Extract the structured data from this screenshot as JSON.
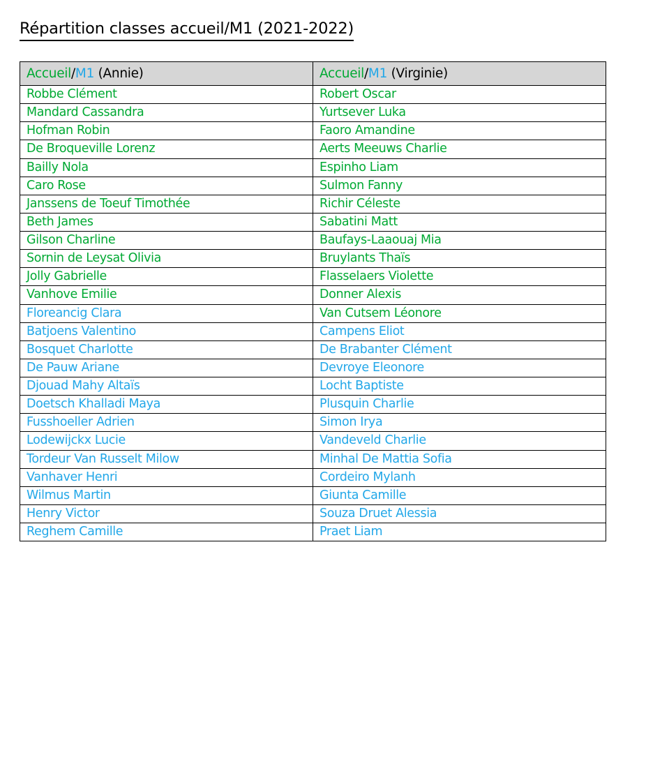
{
  "document": {
    "title": "Répartition classes accueil/M1 (2021-2022)"
  },
  "colors": {
    "accueil_green": "#00a933",
    "m1_blue": "#22a7e8",
    "header_background": "#d6d6d6",
    "border": "#000000",
    "text_black": "#000000"
  },
  "table": {
    "header": {
      "col1": {
        "accueil_label": "Accueil",
        "separator": "/",
        "m1_label": "M1",
        "teacher": "(Annie)"
      },
      "col2": {
        "accueil_label": "Accueil",
        "separator": "/",
        "m1_label": "M1",
        "teacher": "(Virginie)"
      }
    },
    "rows": [
      {
        "col1": {
          "name": "Robbe Clément",
          "group": "accueil"
        },
        "col2": {
          "name": "Robert Oscar",
          "group": "accueil"
        }
      },
      {
        "col1": {
          "name": "Mandard Cassandra",
          "group": "accueil"
        },
        "col2": {
          "name": "Yurtsever Luka",
          "group": "accueil"
        }
      },
      {
        "col1": {
          "name": "Hofman Robin",
          "group": "accueil"
        },
        "col2": {
          "name": "Faoro Amandine",
          "group": "accueil"
        }
      },
      {
        "col1": {
          "name": "De Broqueville Lorenz",
          "group": "accueil"
        },
        "col2": {
          "name": "Aerts Meeuws Charlie",
          "group": "accueil"
        }
      },
      {
        "col1": {
          "name": "Bailly Nola",
          "group": "accueil"
        },
        "col2": {
          "name": "Espinho Liam",
          "group": "accueil"
        }
      },
      {
        "col1": {
          "name": "Caro Rose",
          "group": "accueil"
        },
        "col2": {
          "name": "Sulmon Fanny",
          "group": "accueil"
        }
      },
      {
        "col1": {
          "name": "Janssens de Toeuf Timothée",
          "group": "accueil"
        },
        "col2": {
          "name": "Richir Céleste",
          "group": "accueil"
        }
      },
      {
        "col1": {
          "name": "Beth James",
          "group": "accueil"
        },
        "col2": {
          "name": "Sabatini Matt",
          "group": "accueil"
        }
      },
      {
        "col1": {
          "name": "Gilson Charline",
          "group": "accueil"
        },
        "col2": {
          "name": "Baufays-Laaouaj Mia",
          "group": "accueil"
        }
      },
      {
        "col1": {
          "name": "Sornin de Leysat Olivia",
          "group": "accueil"
        },
        "col2": {
          "name": "Bruylants Thaïs",
          "group": "accueil"
        }
      },
      {
        "col1": {
          "name": "Jolly Gabrielle",
          "group": "accueil"
        },
        "col2": {
          "name": "Flasselaers Violette",
          "group": "accueil"
        }
      },
      {
        "col1": {
          "name": "Vanhove Emilie",
          "group": "accueil"
        },
        "col2": {
          "name": "Donner Alexis",
          "group": "accueil"
        }
      },
      {
        "col1": {
          "name": "Floreancig Clara",
          "group": "m1"
        },
        "col2": {
          "name": "Van Cutsem Léonore",
          "group": "accueil"
        }
      },
      {
        "col1": {
          "name": "Batjoens Valentino",
          "group": "m1"
        },
        "col2": {
          "name": "Campens Eliot",
          "group": "m1"
        }
      },
      {
        "col1": {
          "name": "Bosquet Charlotte",
          "group": "m1"
        },
        "col2": {
          "name": "De Brabanter Clément",
          "group": "m1"
        }
      },
      {
        "col1": {
          "name": "De Pauw Ariane",
          "group": "m1"
        },
        "col2": {
          "name": "Devroye Eleonore",
          "group": "m1"
        }
      },
      {
        "col1": {
          "name": "Djouad Mahy Altaïs",
          "group": "m1"
        },
        "col2": {
          "name": "Locht Baptiste",
          "group": "m1"
        }
      },
      {
        "col1": {
          "name": "Doetsch Khalladi Maya",
          "group": "m1"
        },
        "col2": {
          "name": "Plusquin Charlie",
          "group": "m1"
        }
      },
      {
        "col1": {
          "name": "Fusshoeller Adrien",
          "group": "m1"
        },
        "col2": {
          "name": "Simon Irya",
          "group": "m1"
        }
      },
      {
        "col1": {
          "name": "Lodewijckx Lucie",
          "group": "m1"
        },
        "col2": {
          "name": "Vandeveld Charlie",
          "group": "m1"
        }
      },
      {
        "col1": {
          "name": "Tordeur Van Russelt Milow",
          "group": "m1"
        },
        "col2": {
          "name": "Minhal De Mattia Sofia",
          "group": "m1"
        }
      },
      {
        "col1": {
          "name": "Vanhaver Henri",
          "group": "m1"
        },
        "col2": {
          "name": "Cordeiro Mylanh",
          "group": "m1"
        }
      },
      {
        "col1": {
          "name": "Wilmus Martin",
          "group": "m1"
        },
        "col2": {
          "name": "Giunta Camille",
          "group": "m1"
        }
      },
      {
        "col1": {
          "name": "Henry Victor",
          "group": "m1"
        },
        "col2": {
          "name": "Souza Druet Alessia",
          "group": "m1"
        }
      },
      {
        "col1": {
          "name": "Reghem Camille",
          "group": "m1"
        },
        "col2": {
          "name": "Praet Liam",
          "group": "m1"
        }
      }
    ]
  }
}
